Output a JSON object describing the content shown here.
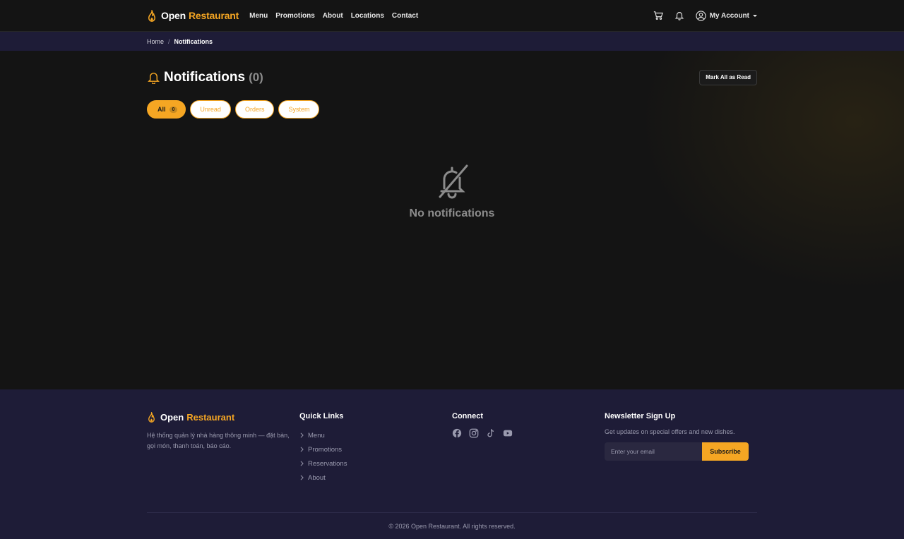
{
  "brand": {
    "word1": "Open",
    "word2": "Restaurant"
  },
  "nav": {
    "links": [
      "Menu",
      "Promotions",
      "About",
      "Locations",
      "Contact"
    ],
    "account_label": "My Account"
  },
  "breadcrumb": {
    "home": "Home",
    "separator": "/",
    "current": "Notifications"
  },
  "page": {
    "title": "Notifications",
    "count": "(0)",
    "mark_all_label": "Mark All as Read",
    "tabs": [
      {
        "label": "All",
        "badge": "0",
        "active": true
      },
      {
        "label": "Unread"
      },
      {
        "label": "Orders"
      },
      {
        "label": "System"
      }
    ],
    "empty_text": "No notifications"
  },
  "footer": {
    "brand": {
      "word1": "Open",
      "word2": "Restaurant"
    },
    "description": "Hệ thống quản lý nhà hàng thông minh — đặt bàn, gọi món, thanh toán, báo cáo.",
    "quick_links_heading": "Quick Links",
    "quick_links": [
      "Menu",
      "Promotions",
      "Reservations",
      "About"
    ],
    "connect_heading": "Connect",
    "social_icons": [
      "facebook-icon",
      "instagram-icon",
      "tiktok-icon",
      "youtube-icon"
    ],
    "newsletter_heading": "Newsletter Sign Up",
    "newsletter_text": "Get updates on special offers and new dishes.",
    "email_placeholder": "Enter your email",
    "subscribe_label": "Subscribe",
    "copyright": "© 2026 Open Restaurant. All rights reserved."
  },
  "colors": {
    "accent": "#f5a623",
    "navy": "#1e1c37",
    "background": "#141414"
  }
}
